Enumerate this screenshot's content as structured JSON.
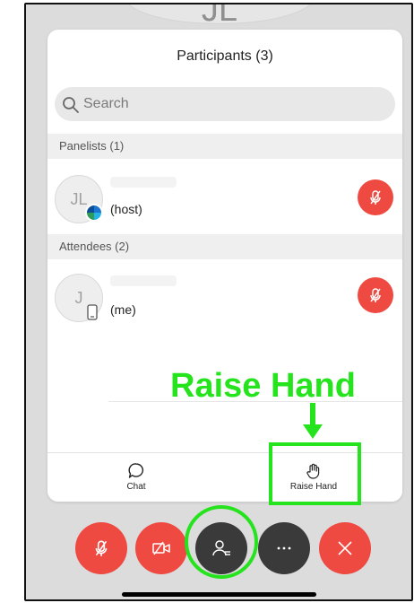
{
  "background": {
    "initials": "JL"
  },
  "panel": {
    "title": "Participants (3)",
    "search_placeholder": "Search",
    "sections": [
      {
        "header": "Panelists (1)",
        "participants": [
          {
            "initials": "JL",
            "role": "(host)",
            "badge": "webex-logo",
            "muted": true
          }
        ]
      },
      {
        "header": "Attendees (2)",
        "participants": [
          {
            "initials": "J",
            "role": "(me)",
            "badge": "phone-device",
            "muted": true
          }
        ]
      }
    ],
    "tabs": [
      {
        "label": "Chat",
        "icon": "chat-bubble-icon"
      },
      {
        "label": "Raise Hand",
        "icon": "raise-hand-icon"
      }
    ]
  },
  "annotation": {
    "text": "Raise Hand",
    "color": "#25e31c"
  },
  "controls": [
    {
      "name": "mute-button",
      "icon": "mic-off-icon",
      "color": "#ee4a42"
    },
    {
      "name": "video-button",
      "icon": "video-off-icon",
      "color": "#ee4a42"
    },
    {
      "name": "participants-button",
      "icon": "participants-icon",
      "color": "#3a3a3a"
    },
    {
      "name": "more-button",
      "icon": "more-icon",
      "color": "#3a3a3a"
    },
    {
      "name": "leave-button",
      "icon": "close-icon",
      "color": "#ee4a42"
    }
  ],
  "colors": {
    "red": "#ee4a42",
    "dark": "#3a3a3a",
    "highlight": "#25e31c"
  }
}
